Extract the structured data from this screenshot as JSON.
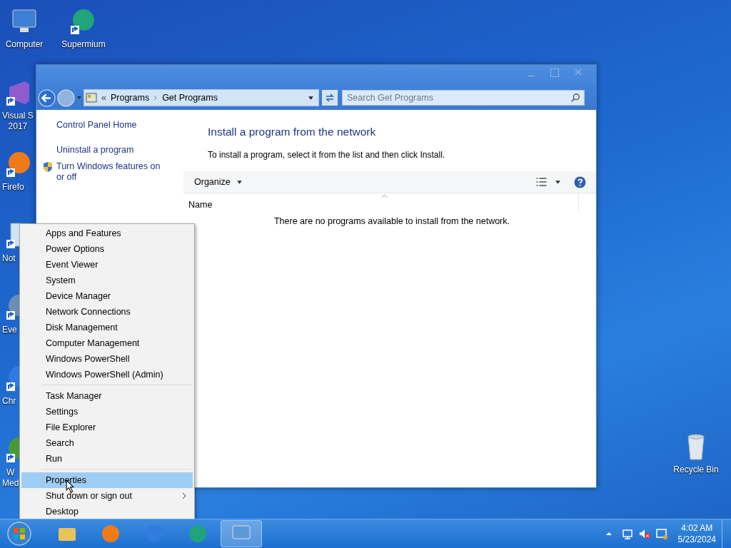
{
  "desktop": {
    "icon_columns": [
      [
        {
          "kind": "computer",
          "lines": [
            "Computer"
          ],
          "shortcut": false
        },
        {
          "kind": "vs",
          "lines": [
            "Visual S",
            "2017"
          ],
          "shortcut": true
        },
        {
          "kind": "firefox",
          "lines": [
            "Firefo"
          ],
          "shortcut": true
        },
        {
          "kind": "notepad",
          "lines": [
            "Not"
          ],
          "shortcut": true
        },
        {
          "kind": "event",
          "lines": [
            "Eve"
          ],
          "shortcut": true
        },
        {
          "kind": "chrome",
          "lines": [
            "Chr"
          ],
          "shortcut": true
        },
        {
          "kind": "wmp",
          "lines": [
            "W",
            "Med"
          ],
          "shortcut": true
        }
      ],
      [
        {
          "kind": "supermium",
          "lines": [
            "Supermium"
          ],
          "shortcut": true
        }
      ]
    ],
    "recycle_bin": {
      "label": "Recycle Bin"
    }
  },
  "window": {
    "breadcrumb_chevron": "«",
    "breadcrumb": [
      "Programs",
      "Get Programs"
    ],
    "search": {
      "placeholder": "Search Get Programs"
    },
    "sidebar": {
      "items": [
        {
          "label": "Control Panel Home",
          "shield": false
        },
        {
          "label": "Uninstall a program",
          "shield": false
        },
        {
          "label": "Turn Windows features on or off",
          "shield": true
        }
      ]
    },
    "heading": "Install a program from the network",
    "description": "To install a program, select it from the list and then click Install.",
    "toolbar": {
      "organize": "Organize"
    },
    "table": {
      "columns": [
        "Name"
      ]
    },
    "empty_message": "There are no programs available to install from the network."
  },
  "context_menu": {
    "groups": [
      [
        {
          "label": "Apps and Features",
          "selected": false,
          "submenu": false
        },
        {
          "label": "Power Options",
          "selected": false,
          "submenu": false
        },
        {
          "label": "Event Viewer",
          "selected": false,
          "submenu": false
        },
        {
          "label": "System",
          "selected": false,
          "submenu": false
        },
        {
          "label": "Device Manager",
          "selected": false,
          "submenu": false
        },
        {
          "label": "Network Connections",
          "selected": false,
          "submenu": false
        },
        {
          "label": "Disk Management",
          "selected": false,
          "submenu": false
        },
        {
          "label": "Computer Management",
          "selected": false,
          "submenu": false
        },
        {
          "label": "Windows PowerShell",
          "selected": false,
          "submenu": false
        },
        {
          "label": "Windows PowerShell (Admin)",
          "selected": false,
          "submenu": false
        }
      ],
      [
        {
          "label": "Task Manager",
          "selected": false,
          "submenu": false
        },
        {
          "label": "Settings",
          "selected": false,
          "submenu": false
        },
        {
          "label": "File Explorer",
          "selected": false,
          "submenu": false
        },
        {
          "label": "Search",
          "selected": false,
          "submenu": false
        },
        {
          "label": "Run",
          "selected": false,
          "submenu": false
        }
      ],
      [
        {
          "label": "Properties",
          "selected": true,
          "submenu": false
        },
        {
          "label": "Shut down or sign out",
          "selected": false,
          "submenu": true
        },
        {
          "label": "Desktop",
          "selected": false,
          "submenu": false
        }
      ]
    ]
  },
  "taskbar": {
    "apps": [
      {
        "kind": "explorer",
        "selected": false
      },
      {
        "kind": "firefox",
        "selected": false
      },
      {
        "kind": "chrome",
        "selected": false
      },
      {
        "kind": "supermium",
        "selected": false
      },
      {
        "kind": "controlpanel",
        "selected": true
      }
    ],
    "clock": {
      "time": "4:02 AM",
      "date": "5/23/2024"
    }
  }
}
